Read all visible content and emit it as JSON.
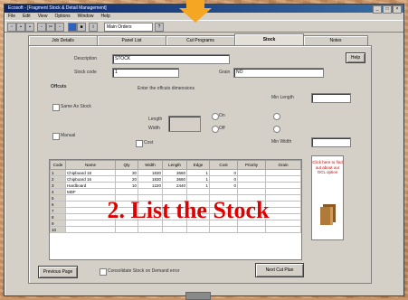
{
  "window": {
    "title": "Ecosoft - [Fragment Stock & Detail Management]",
    "menu": [
      "File",
      "Edit",
      "View",
      "Options",
      "Window",
      "Help"
    ],
    "toolbar_select": "Main Orders"
  },
  "tabs": [
    {
      "label": "Job Details"
    },
    {
      "label": "Panel List"
    },
    {
      "label": "Cut Programs"
    },
    {
      "label": "Stock"
    },
    {
      "label": "Notes"
    }
  ],
  "form": {
    "description_label": "Description",
    "description_value": "STOCK",
    "stock_code_label": "Stock code",
    "stock_code_value": "1",
    "grain_label": "Grain",
    "grain_value": "NO",
    "help_button": "Help",
    "offcuts_label": "Offcuts",
    "offcuts_hint": "Enter the offcuts dimensions",
    "same_as_stock_label": "Same As Stock",
    "manual_label": "Manual",
    "length_label": "Length",
    "width_label": "Width",
    "use_label": "Use",
    "option_a": "On",
    "option_b": "Off",
    "min_length_label": "Min Length",
    "min_width_label": "Min Width",
    "cost_label": "Cost"
  },
  "table": {
    "columns": [
      "Code",
      "Name",
      "Qty",
      "Width",
      "Length",
      "Edge",
      "Cost",
      "Priority",
      "Grain"
    ],
    "rows": [
      [
        "1",
        "Chipboard 18",
        "30",
        "1830",
        "3660",
        "1",
        "0",
        "",
        ""
      ],
      [
        "2",
        "Chipboard 16",
        "20",
        "1830",
        "3660",
        "1",
        "0",
        "",
        ""
      ],
      [
        "3",
        "Hardboard",
        "10",
        "1220",
        "2440",
        "1",
        "0",
        "",
        ""
      ],
      [
        "4",
        "MDF",
        "",
        "",
        "",
        "",
        "",
        "",
        ""
      ],
      [
        "5",
        "",
        "",
        "",
        "",
        "",
        "",
        "",
        ""
      ],
      [
        "6",
        "",
        "",
        "",
        "",
        "",
        "",
        "",
        ""
      ],
      [
        "7",
        "",
        "",
        "",
        "",
        "",
        "",
        "",
        ""
      ],
      [
        "8",
        "",
        "",
        "",
        "",
        "",
        "",
        "",
        ""
      ],
      [
        "9",
        "",
        "",
        "",
        "",
        "",
        "",
        "",
        ""
      ],
      [
        "10",
        "",
        "",
        "",
        "",
        "",
        "",
        "",
        ""
      ]
    ]
  },
  "promo": {
    "text": "Click here to find out about our OCL option"
  },
  "footer": {
    "prev_button": "Previous Page",
    "checkbox_label": "Consolidate Stock on Demand error",
    "next_button": "Next Cut Plan"
  },
  "overlay_caption": "2. List the Stock",
  "colors": {
    "arrow": "#f5a623",
    "caption": "#e00000",
    "titlebar": "#0a246a"
  }
}
